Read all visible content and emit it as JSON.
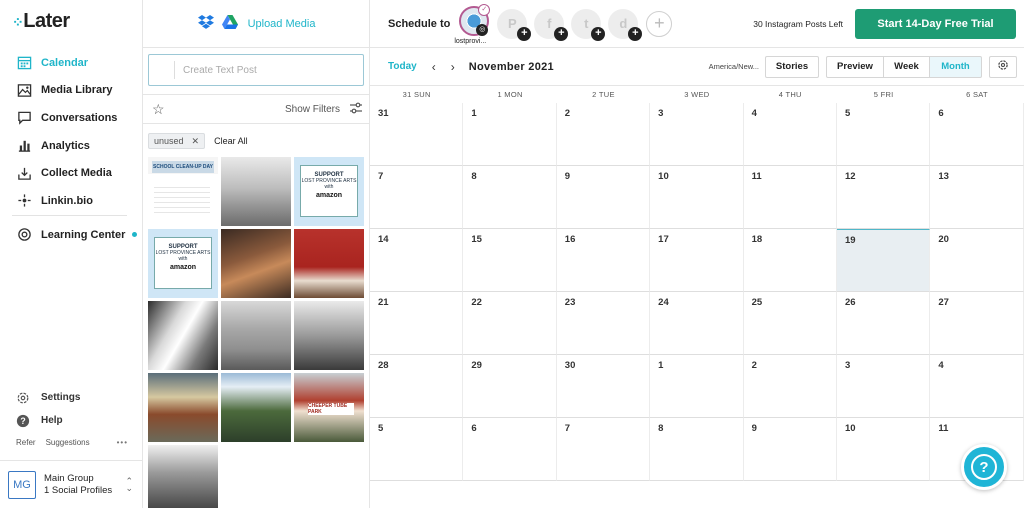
{
  "app": {
    "logo_text": "Later"
  },
  "sidebar": {
    "items": [
      {
        "label": "Calendar",
        "icon": "calendar-icon",
        "active": true
      },
      {
        "label": "Media Library",
        "icon": "image-icon",
        "active": false
      },
      {
        "label": "Conversations",
        "icon": "chat-icon",
        "active": false
      },
      {
        "label": "Analytics",
        "icon": "bar-chart-icon",
        "active": false
      },
      {
        "label": "Collect Media",
        "icon": "download-tray-icon",
        "active": false
      },
      {
        "label": "Linkin.bio",
        "icon": "link-icon",
        "active": false
      }
    ],
    "learning_center": "Learning Center",
    "settings": "Settings",
    "help": "Help",
    "refer": "Refer",
    "suggestions": "Suggestions",
    "more": "•••",
    "group": {
      "initials": "MG",
      "name": "Main Group",
      "profiles": "1 Social Profiles"
    }
  },
  "media": {
    "upload_label": "Upload Media",
    "text_post_placeholder": "Create Text Post",
    "show_filters": "Show Filters",
    "tag": "unused",
    "clear_all": "Clear All",
    "thumb_texts": {
      "cleanup": "SCHOOL CLEAN-UP DAY",
      "support": "SUPPORT",
      "lost_province": "LOST PROVINCE ARTS",
      "with": "with",
      "amazon": "amazon",
      "sign": "CHEEPER TUBE PARK"
    }
  },
  "header": {
    "schedule_to": "Schedule to",
    "profile_name": "lostprovi...",
    "networks": [
      "P",
      "f",
      "t",
      "d"
    ],
    "posts_left": "30 Instagram Posts Left",
    "trial_button": "Start 14-Day Free Trial"
  },
  "toolbar": {
    "today": "Today",
    "prev": "‹",
    "next": "›",
    "month": "November 2021",
    "timezone": "America/New...",
    "stories": "Stories",
    "preview": "Preview",
    "week": "Week",
    "month_view": "Month"
  },
  "calendar": {
    "days_of_week": [
      "31 SUN",
      "1 MON",
      "2 TUE",
      "3 WED",
      "4 THU",
      "5 FRI",
      "6 SAT"
    ],
    "weeks": [
      [
        "31",
        "1",
        "2",
        "3",
        "4",
        "5",
        "6"
      ],
      [
        "7",
        "8",
        "9",
        "10",
        "11",
        "12",
        "13"
      ],
      [
        "14",
        "15",
        "16",
        "17",
        "18",
        "19",
        "20"
      ],
      [
        "21",
        "22",
        "23",
        "24",
        "25",
        "26",
        "27"
      ],
      [
        "28",
        "29",
        "30",
        "1",
        "2",
        "3",
        "4"
      ],
      [
        "5",
        "6",
        "7",
        "8",
        "9",
        "10",
        "11"
      ]
    ],
    "today_date": "19"
  },
  "help_button": "?"
}
